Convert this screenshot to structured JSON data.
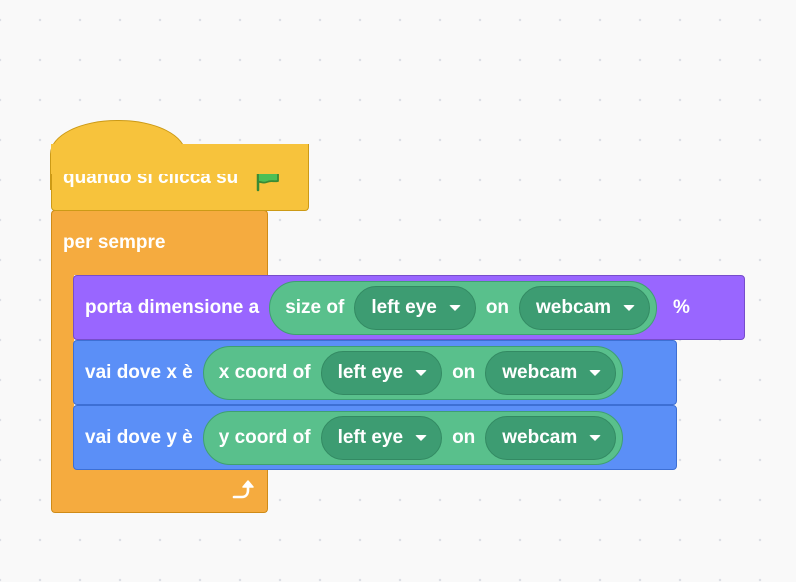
{
  "colors": {
    "canvas": "#f9f9f9",
    "events": "#f7c33c",
    "control": "#f5ab3f",
    "looks": "#9966ff",
    "motion": "#5b8ff7",
    "extension_reporter": "#59c08c",
    "extension_dropdown": "#3d9c72"
  },
  "hat_block": {
    "label": "quando si clicca su",
    "icon": "green-flag-icon"
  },
  "forever_block": {
    "label": "per sempre",
    "icon": "loop-arrow-icon"
  },
  "size_block": {
    "label": "porta dimensione a",
    "reporter": {
      "prefix": "size of",
      "part": "left eye",
      "conj": "on",
      "source": "webcam"
    },
    "suffix": "%"
  },
  "goto_x_block": {
    "label": "vai dove x è",
    "reporter": {
      "prefix": "x coord of",
      "part": "left eye",
      "conj": "on",
      "source": "webcam"
    }
  },
  "goto_y_block": {
    "label": "vai dove y è",
    "reporter": {
      "prefix": "y coord of",
      "part": "left eye",
      "conj": "on",
      "source": "webcam"
    }
  }
}
